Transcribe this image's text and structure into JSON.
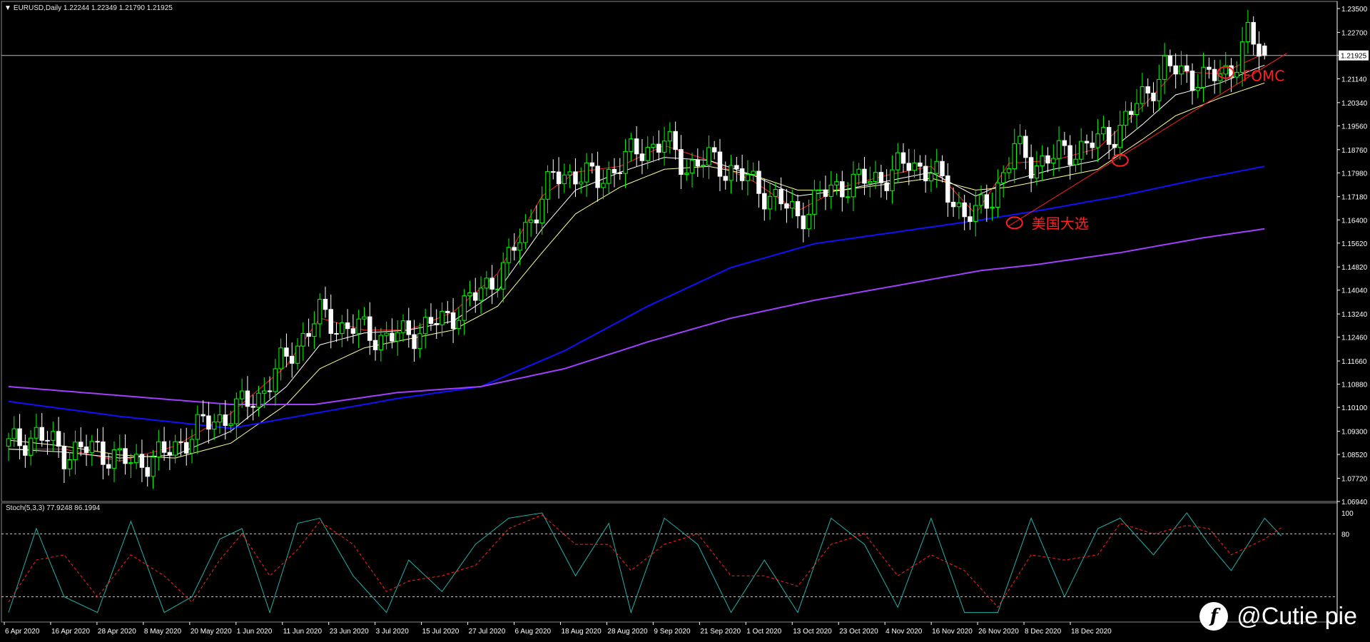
{
  "header": {
    "symbol_line": "EURUSD,Daily  1.22244 1.22349 1.21790 1.21925",
    "indicator_line": "Stoch(5,3,3) 77.9248 86.1994"
  },
  "watermark": {
    "text": "@Cutie pie",
    "logo_icon": "bilibili-like-logo-icon"
  },
  "colors": {
    "background": "#000000",
    "axis": "#ffffff",
    "bull_candle": "#00ff00",
    "bear_candle": "#ffffff",
    "ma_fast": "#ff2020",
    "ma_mid": "#ffffff",
    "ma_slow": "#ffff99",
    "ma_100": "#1010ff",
    "ma_200": "#a040ff",
    "annotation": "#ff2020",
    "stoch_main": "#20b2aa",
    "stoch_signal": "#ff2020"
  },
  "chart_data": [
    {
      "type": "candlestick",
      "title": "EURUSD,Daily",
      "ohlc_last": {
        "open": 1.22244,
        "high": 1.22349,
        "low": 1.2179,
        "close": 1.21925
      },
      "current_price_label": "1.21925",
      "ylim": [
        1.0694,
        1.235
      ],
      "y_ticks": [
        "1.23500",
        "1.22700",
        "1.21925",
        "1.21140",
        "1.20340",
        "1.19560",
        "1.18760",
        "1.17980",
        "1.17180",
        "1.16400",
        "1.15620",
        "1.14820",
        "1.14040",
        "1.13240",
        "1.12460",
        "1.11660",
        "1.10880",
        "1.10100",
        "1.09300",
        "1.08520",
        "1.07720",
        "1.06940"
      ],
      "x_ticks": [
        "6 Apr 2020",
        "16 Apr 2020",
        "28 Apr 2020",
        "8 May 2020",
        "20 May 2020",
        "1 Jun 2020",
        "11 Jun 2020",
        "23 Jun 2020",
        "3 Jul 2020",
        "15 Jul 2020",
        "27 Jul 2020",
        "6 Aug 2020",
        "18 Aug 2020",
        "28 Aug 2020",
        "9 Sep 2020",
        "21 Sep 2020",
        "1 Oct 2020",
        "13 Oct 2020",
        "23 Oct 2020",
        "4 Nov 2020",
        "16 Nov 2020",
        "26 Nov 2020",
        "8 Dec 2020",
        "18 Dec 2020"
      ],
      "close_path": [
        [
          0,
          1.088
        ],
        [
          5,
          1.092
        ],
        [
          10,
          1.086
        ],
        [
          16,
          1.087
        ],
        [
          22,
          1.082
        ],
        [
          28,
          1.085
        ],
        [
          35,
          1.095
        ],
        [
          40,
          1.099
        ],
        [
          45,
          1.105
        ],
        [
          49,
          1.115
        ],
        [
          53,
          1.125
        ],
        [
          56,
          1.132
        ],
        [
          60,
          1.128
        ],
        [
          64,
          1.127
        ],
        [
          68,
          1.124
        ],
        [
          72,
          1.126
        ],
        [
          78,
          1.13
        ],
        [
          84,
          1.138
        ],
        [
          90,
          1.15
        ],
        [
          94,
          1.165
        ],
        [
          98,
          1.178
        ],
        [
          102,
          1.18
        ],
        [
          106,
          1.177
        ],
        [
          110,
          1.183
        ],
        [
          114,
          1.188
        ],
        [
          118,
          1.19
        ],
        [
          122,
          1.182
        ],
        [
          126,
          1.184
        ],
        [
          130,
          1.181
        ],
        [
          134,
          1.176
        ],
        [
          138,
          1.171
        ],
        [
          142,
          1.165
        ],
        [
          146,
          1.172
        ],
        [
          150,
          1.176
        ],
        [
          154,
          1.177
        ],
        [
          158,
          1.179
        ],
        [
          162,
          1.183
        ],
        [
          166,
          1.181
        ],
        [
          170,
          1.17
        ],
        [
          174,
          1.165
        ],
        [
          177,
          1.172
        ],
        [
          181,
          1.188
        ],
        [
          184,
          1.183
        ],
        [
          188,
          1.185
        ],
        [
          192,
          1.188
        ],
        [
          196,
          1.19
        ],
        [
          200,
          1.195
        ],
        [
          204,
          1.205
        ],
        [
          208,
          1.215
        ],
        [
          212,
          1.213
        ],
        [
          216,
          1.211
        ],
        [
          220,
          1.215
        ],
        [
          223,
          1.225
        ],
        [
          226,
          1.2192
        ]
      ],
      "series": [
        {
          "name": "MA fast",
          "path": [
            [
              0,
              1.087
            ],
            [
              10,
              1.087
            ],
            [
              20,
              1.083
            ],
            [
              30,
              1.088
            ],
            [
              40,
              1.099
            ],
            [
              50,
              1.115
            ],
            [
              56,
              1.131
            ],
            [
              64,
              1.127
            ],
            [
              72,
              1.127
            ],
            [
              80,
              1.133
            ],
            [
              88,
              1.146
            ],
            [
              96,
              1.172
            ],
            [
              102,
              1.18
            ],
            [
              110,
              1.182
            ],
            [
              118,
              1.189
            ],
            [
              126,
              1.184
            ],
            [
              134,
              1.177
            ],
            [
              142,
              1.167
            ],
            [
              150,
              1.175
            ],
            [
              158,
              1.179
            ],
            [
              166,
              1.182
            ],
            [
              174,
              1.166
            ],
            [
              180,
              1.183
            ],
            [
              188,
              1.184
            ],
            [
              196,
              1.188
            ],
            [
              204,
              1.202
            ],
            [
              210,
              1.214
            ],
            [
              218,
              1.213
            ],
            [
              226,
              1.22
            ]
          ]
        },
        {
          "name": "MA mid",
          "path": [
            [
              0,
              1.087
            ],
            [
              10,
              1.086
            ],
            [
              20,
              1.084
            ],
            [
              30,
              1.085
            ],
            [
              40,
              1.093
            ],
            [
              50,
              1.108
            ],
            [
              56,
              1.122
            ],
            [
              64,
              1.126
            ],
            [
              72,
              1.127
            ],
            [
              80,
              1.13
            ],
            [
              88,
              1.14
            ],
            [
              96,
              1.161
            ],
            [
              102,
              1.174
            ],
            [
              110,
              1.18
            ],
            [
              118,
              1.185
            ],
            [
              126,
              1.184
            ],
            [
              134,
              1.179
            ],
            [
              142,
              1.172
            ],
            [
              150,
              1.174
            ],
            [
              158,
              1.177
            ],
            [
              166,
              1.18
            ],
            [
              174,
              1.172
            ],
            [
              180,
              1.177
            ],
            [
              188,
              1.181
            ],
            [
              196,
              1.184
            ],
            [
              204,
              1.196
            ],
            [
              210,
              1.206
            ],
            [
              218,
              1.21
            ],
            [
              226,
              1.216
            ]
          ]
        },
        {
          "name": "MA slow",
          "path": [
            [
              0,
              1.09
            ],
            [
              10,
              1.088
            ],
            [
              20,
              1.085
            ],
            [
              30,
              1.084
            ],
            [
              40,
              1.089
            ],
            [
              50,
              1.102
            ],
            [
              56,
              1.114
            ],
            [
              64,
              1.121
            ],
            [
              72,
              1.124
            ],
            [
              80,
              1.127
            ],
            [
              88,
              1.135
            ],
            [
              96,
              1.153
            ],
            [
              102,
              1.166
            ],
            [
              110,
              1.175
            ],
            [
              118,
              1.181
            ],
            [
              126,
              1.182
            ],
            [
              134,
              1.179
            ],
            [
              142,
              1.174
            ],
            [
              150,
              1.174
            ],
            [
              158,
              1.176
            ],
            [
              166,
              1.178
            ],
            [
              174,
              1.174
            ],
            [
              180,
              1.175
            ],
            [
              188,
              1.178
            ],
            [
              196,
              1.181
            ],
            [
              204,
              1.191
            ],
            [
              210,
              1.199
            ],
            [
              218,
              1.205
            ],
            [
              226,
              1.21
            ]
          ]
        },
        {
          "name": "MA 100",
          "path": [
            [
              0,
              1.103
            ],
            [
              20,
              1.098
            ],
            [
              40,
              1.094
            ],
            [
              55,
              1.099
            ],
            [
              70,
              1.104
            ],
            [
              85,
              1.108
            ],
            [
              100,
              1.12
            ],
            [
              115,
              1.135
            ],
            [
              130,
              1.148
            ],
            [
              145,
              1.156
            ],
            [
              160,
              1.16
            ],
            [
              175,
              1.164
            ],
            [
              185,
              1.167
            ],
            [
              200,
              1.172
            ],
            [
              215,
              1.178
            ],
            [
              226,
              1.182
            ]
          ]
        },
        {
          "name": "MA 200",
          "path": [
            [
              0,
              1.108
            ],
            [
              20,
              1.105
            ],
            [
              40,
              1.102
            ],
            [
              55,
              1.102
            ],
            [
              70,
              1.106
            ],
            [
              85,
              1.108
            ],
            [
              100,
              1.114
            ],
            [
              115,
              1.123
            ],
            [
              130,
              1.131
            ],
            [
              145,
              1.137
            ],
            [
              160,
              1.142
            ],
            [
              175,
              1.147
            ],
            [
              185,
              1.149
            ],
            [
              200,
              1.153
            ],
            [
              215,
              1.158
            ],
            [
              226,
              1.161
            ]
          ]
        }
      ],
      "trendlines": [
        {
          "from": [
            180,
            1.162
          ],
          "to": [
            230,
            1.22
          ]
        }
      ],
      "annotations": [
        {
          "text": "美国大选",
          "at": [
            181,
            1.163
          ]
        },
        {
          "text": "FOMC",
          "at": [
            219,
            1.2135
          ]
        },
        {
          "text": "",
          "at": [
            200,
            1.184
          ]
        }
      ]
    },
    {
      "type": "line",
      "title": "Stoch(5,3,3)",
      "values_last": {
        "main": 77.9248,
        "signal": 86.1994
      },
      "ylim": [
        0,
        100
      ],
      "y_ticks": [
        "100",
        "80"
      ],
      "levels": [
        80,
        20
      ],
      "main_path": [
        [
          0,
          5
        ],
        [
          5,
          85
        ],
        [
          10,
          20
        ],
        [
          16,
          5
        ],
        [
          22,
          92
        ],
        [
          28,
          5
        ],
        [
          33,
          20
        ],
        [
          38,
          75
        ],
        [
          42,
          85
        ],
        [
          47,
          5
        ],
        [
          52,
          90
        ],
        [
          56,
          95
        ],
        [
          62,
          40
        ],
        [
          68,
          5
        ],
        [
          72,
          55
        ],
        [
          78,
          25
        ],
        [
          84,
          70
        ],
        [
          90,
          95
        ],
        [
          96,
          100
        ],
        [
          102,
          40
        ],
        [
          108,
          90
        ],
        [
          112,
          5
        ],
        [
          118,
          95
        ],
        [
          124,
          70
        ],
        [
          130,
          5
        ],
        [
          136,
          55
        ],
        [
          142,
          5
        ],
        [
          148,
          95
        ],
        [
          154,
          70
        ],
        [
          160,
          10
        ],
        [
          166,
          95
        ],
        [
          172,
          5
        ],
        [
          178,
          5
        ],
        [
          184,
          95
        ],
        [
          190,
          20
        ],
        [
          196,
          85
        ],
        [
          200,
          95
        ],
        [
          206,
          60
        ],
        [
          212,
          100
        ],
        [
          216,
          70
        ],
        [
          220,
          45
        ],
        [
          226,
          95
        ],
        [
          229,
          78
        ]
      ],
      "signal_path": [
        [
          0,
          15
        ],
        [
          5,
          55
        ],
        [
          10,
          60
        ],
        [
          16,
          20
        ],
        [
          22,
          60
        ],
        [
          28,
          40
        ],
        [
          33,
          15
        ],
        [
          38,
          55
        ],
        [
          42,
          80
        ],
        [
          47,
          40
        ],
        [
          52,
          65
        ],
        [
          56,
          92
        ],
        [
          62,
          70
        ],
        [
          68,
          25
        ],
        [
          72,
          35
        ],
        [
          78,
          40
        ],
        [
          84,
          50
        ],
        [
          90,
          85
        ],
        [
          96,
          98
        ],
        [
          102,
          70
        ],
        [
          108,
          70
        ],
        [
          112,
          45
        ],
        [
          118,
          70
        ],
        [
          124,
          80
        ],
        [
          130,
          40
        ],
        [
          136,
          40
        ],
        [
          142,
          30
        ],
        [
          148,
          70
        ],
        [
          154,
          80
        ],
        [
          160,
          40
        ],
        [
          166,
          60
        ],
        [
          172,
          45
        ],
        [
          178,
          10
        ],
        [
          184,
          60
        ],
        [
          190,
          55
        ],
        [
          196,
          60
        ],
        [
          200,
          90
        ],
        [
          206,
          80
        ],
        [
          212,
          88
        ],
        [
          216,
          85
        ],
        [
          220,
          60
        ],
        [
          226,
          75
        ],
        [
          229,
          86
        ]
      ]
    }
  ]
}
